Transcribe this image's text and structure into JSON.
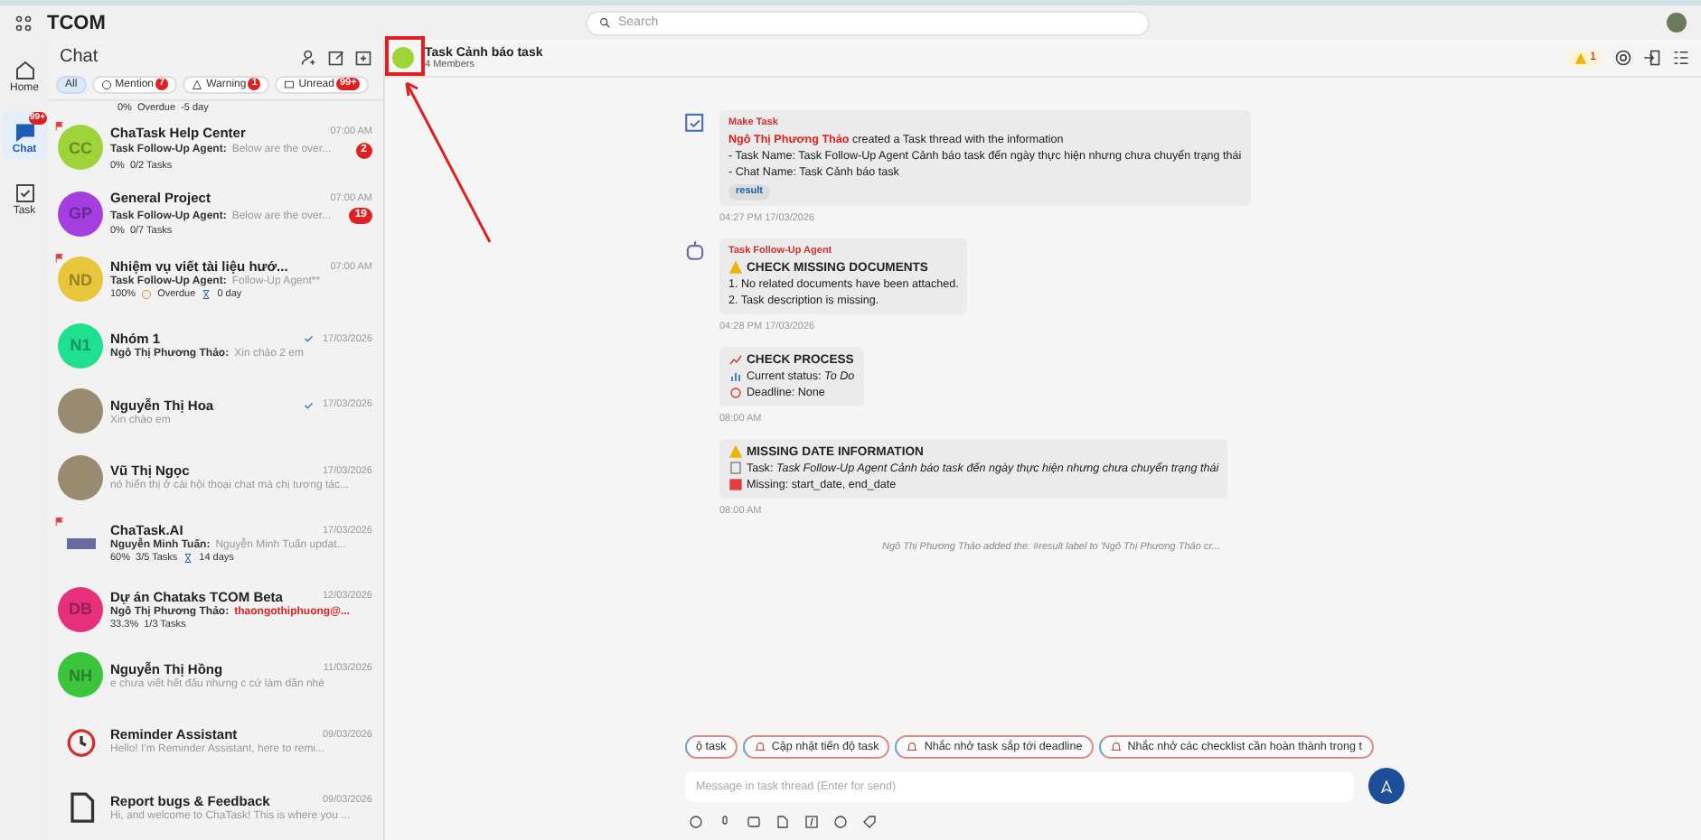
{
  "app": {
    "title": "TCOM",
    "search_placeholder": "Search"
  },
  "rail": [
    {
      "kind": "home",
      "label": "Home",
      "selected": false
    },
    {
      "kind": "chat",
      "label": "Chat",
      "selected": true,
      "badge": "99+"
    },
    {
      "kind": "task",
      "label": "Task",
      "selected": false
    }
  ],
  "chat_list": {
    "title": "Chat",
    "filters": [
      {
        "kind": "all",
        "label": "All",
        "selected": true
      },
      {
        "kind": "mention",
        "label": "Mention",
        "selected": false,
        "badge": "7"
      },
      {
        "kind": "warning",
        "label": "Warning",
        "selected": false,
        "badge": "1"
      },
      {
        "kind": "unread",
        "label": "Unread",
        "selected": false,
        "badge": "99+"
      }
    ],
    "partial_stats": {
      "percent": "0%",
      "overdue": "Overdue",
      "days": "-5 day"
    },
    "items": [
      {
        "name": "ChaTask Help Center",
        "time": "07:00 AM",
        "sender": "Task Follow-Up Agent:",
        "preview": "Below are the over...",
        "badge": "2",
        "percent": "0%",
        "tasks": "0/2 Tasks",
        "pinned": true,
        "avatar": {
          "kind": "initials",
          "text": "CC",
          "color": "#9ed43a"
        }
      },
      {
        "name": "General Project",
        "time": "07:00 AM",
        "sender": "Task Follow-Up Agent:",
        "preview": "Below are the over...",
        "badge": "19",
        "percent": "0%",
        "tasks": "0/7 Tasks",
        "pinned": false,
        "avatar": {
          "kind": "initials",
          "text": "GP",
          "color": "#a53ee0"
        }
      },
      {
        "name": "Nhiệm vụ viết tài liệu hướ...",
        "time": "07:00 AM",
        "sender": "Task Follow-Up Agent:",
        "preview": "Follow-Up Agent**",
        "percent": "100%",
        "overdue": "Overdue",
        "days": "0 day",
        "pinned": true,
        "avatar": {
          "kind": "initials",
          "text": "ND",
          "color": "#e8c53a"
        }
      },
      {
        "name": "Nhóm 1",
        "time": "17/03/2026",
        "sender": "Ngô Thị Phương Thảo:",
        "preview": "Xin chào 2 em",
        "read": true,
        "pinned": false,
        "avatar": {
          "kind": "initials",
          "text": "N1",
          "color": "#1fe08e"
        }
      },
      {
        "name": "Nguyễn Thị Hoa",
        "time": "17/03/2026",
        "preview": "Xin chào em",
        "read": true,
        "pinned": false,
        "avatar": {
          "kind": "photo"
        }
      },
      {
        "name": "Vũ Thị Ngọc",
        "time": "17/03/2026",
        "preview": "nó hiển thị ở cái hội thoại chat mà chị tương tác...",
        "pinned": false,
        "avatar": {
          "kind": "photo"
        }
      },
      {
        "name": "ChaTask.AI",
        "time": "17/03/2026",
        "sender": "Nguyễn Minh Tuấn:",
        "preview": "Nguyễn Minh Tuấn updat...",
        "percent": "60%",
        "tasks": "3/5 Tasks",
        "days": "14 days",
        "pinned": true,
        "avatar": {
          "kind": "logo"
        }
      },
      {
        "name": "Dự án Chataks TCOM Beta",
        "time": "12/03/2026",
        "sender": "Ngô Thị Phương Thảo:",
        "preview": "thaongothiphuong@...",
        "mention": true,
        "percent": "33.3%",
        "tasks": "1/3 Tasks",
        "pinned": false,
        "avatar": {
          "kind": "initials",
          "text": "DB",
          "color": "#e6307c"
        }
      },
      {
        "name": "Nguyễn Thị Hồng",
        "time": "11/03/2026",
        "preview": "e chưa viết hết đâu nhưng c cứ làm dần nhé",
        "pinned": false,
        "avatar": {
          "kind": "initials",
          "text": "NH",
          "color": "#3cc43c"
        }
      },
      {
        "name": "Reminder Assistant",
        "time": "09/03/2026",
        "preview": "Hello! I'm Reminder Assistant, here to remi...",
        "pinned": false,
        "avatar": {
          "kind": "clock"
        }
      },
      {
        "name": "Report bugs & Feedback",
        "time": "09/03/2026",
        "preview": "Hi, and welcome to ChaTask! This is where you ...",
        "pinned": false,
        "avatar": {
          "kind": "document"
        }
      }
    ]
  },
  "thread": {
    "title": "Task Cảnh báo task",
    "members": "4 Members",
    "warning_count": "1",
    "messages": [
      {
        "kind": "card",
        "sender": "Make Task",
        "actor": "Ngô Thị Phương Thảo",
        "lead": "created a Task thread with the information",
        "lines": [
          {
            "heading": false,
            "text": "- Task Name: Task Follow-Up Agent Cảnh báo task đến ngày thực hiện nhưng chưa chuyển trạng thái"
          },
          {
            "heading": false,
            "text": "- Chat Name: Task Cảnh báo task"
          }
        ],
        "tag": "result",
        "time": "04:27 PM 17/03/2026"
      },
      {
        "kind": "card",
        "sender": "Task Follow-Up Agent",
        "lines": [
          {
            "heading": true,
            "text": "CHECK MISSING DOCUMENTS"
          },
          {
            "heading": false,
            "text": "1. No related documents have been attached."
          },
          {
            "heading": false,
            "text": "2. Task description is missing."
          }
        ],
        "time": "04:28 PM 17/03/2026"
      },
      {
        "kind": "card",
        "lines": [
          {
            "heading": true,
            "text": "CHECK PROCESS"
          },
          {
            "heading": false,
            "text": "Current status: *To Do*"
          },
          {
            "heading": false,
            "text": "Deadline: None"
          }
        ],
        "time": "08:00 AM"
      },
      {
        "kind": "card",
        "lines": [
          {
            "heading": true,
            "text": "MISSING DATE INFORMATION"
          },
          {
            "heading": false,
            "text": "Task: *Task Follow-Up Agent Cảnh báo task đến ngày thực hiện nhưng chưa chuyển trạng thái*"
          },
          {
            "heading": false,
            "text": "Missing: start_date, end_date"
          }
        ],
        "time": "08:00 AM"
      },
      {
        "kind": "system",
        "text": "Ngô Thị Phương Thảo added the: #result label to 'Ngô Thị Phương Thảo cr..."
      }
    ],
    "suggestions": [
      "ộ task",
      "Cập nhật tiến độ task",
      "Nhắc nhở task sắp tới deadline",
      "Nhắc nhở các checklist cần hoàn thành trong t"
    ],
    "composer_placeholder": "Message in task thread (Enter for send)"
  }
}
